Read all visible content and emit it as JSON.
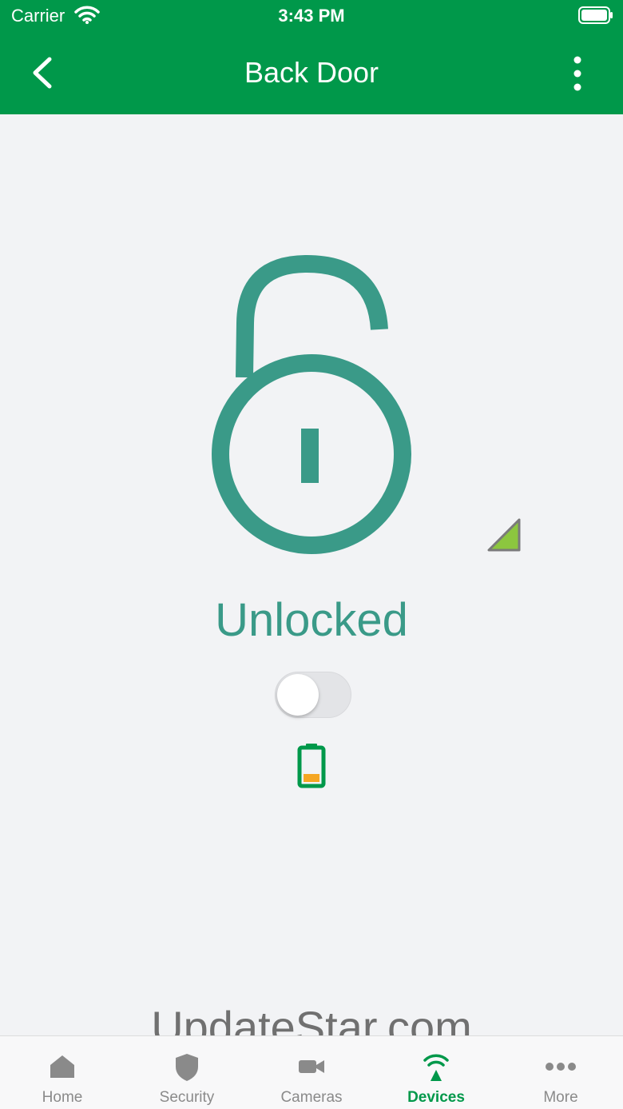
{
  "status_bar": {
    "carrier": "Carrier",
    "time": "3:43 PM"
  },
  "header": {
    "title": "Back Door"
  },
  "lock": {
    "state": "Unlocked",
    "toggle_on": false,
    "battery_level": 0.25
  },
  "watermark": "UpdateStar.com",
  "tabs": [
    {
      "label": "Home",
      "icon": "home-icon"
    },
    {
      "label": "Security",
      "icon": "shield-icon"
    },
    {
      "label": "Cameras",
      "icon": "camera-icon"
    },
    {
      "label": "Devices",
      "icon": "devices-icon",
      "active": true
    },
    {
      "label": "More",
      "icon": "more-icon"
    }
  ],
  "colors": {
    "brand_green": "#00984a",
    "lock_teal": "#3a9a88",
    "tab_inactive": "#8a8a8a",
    "battery_orange": "#f5a623",
    "signal_green": "#8cc63f"
  }
}
